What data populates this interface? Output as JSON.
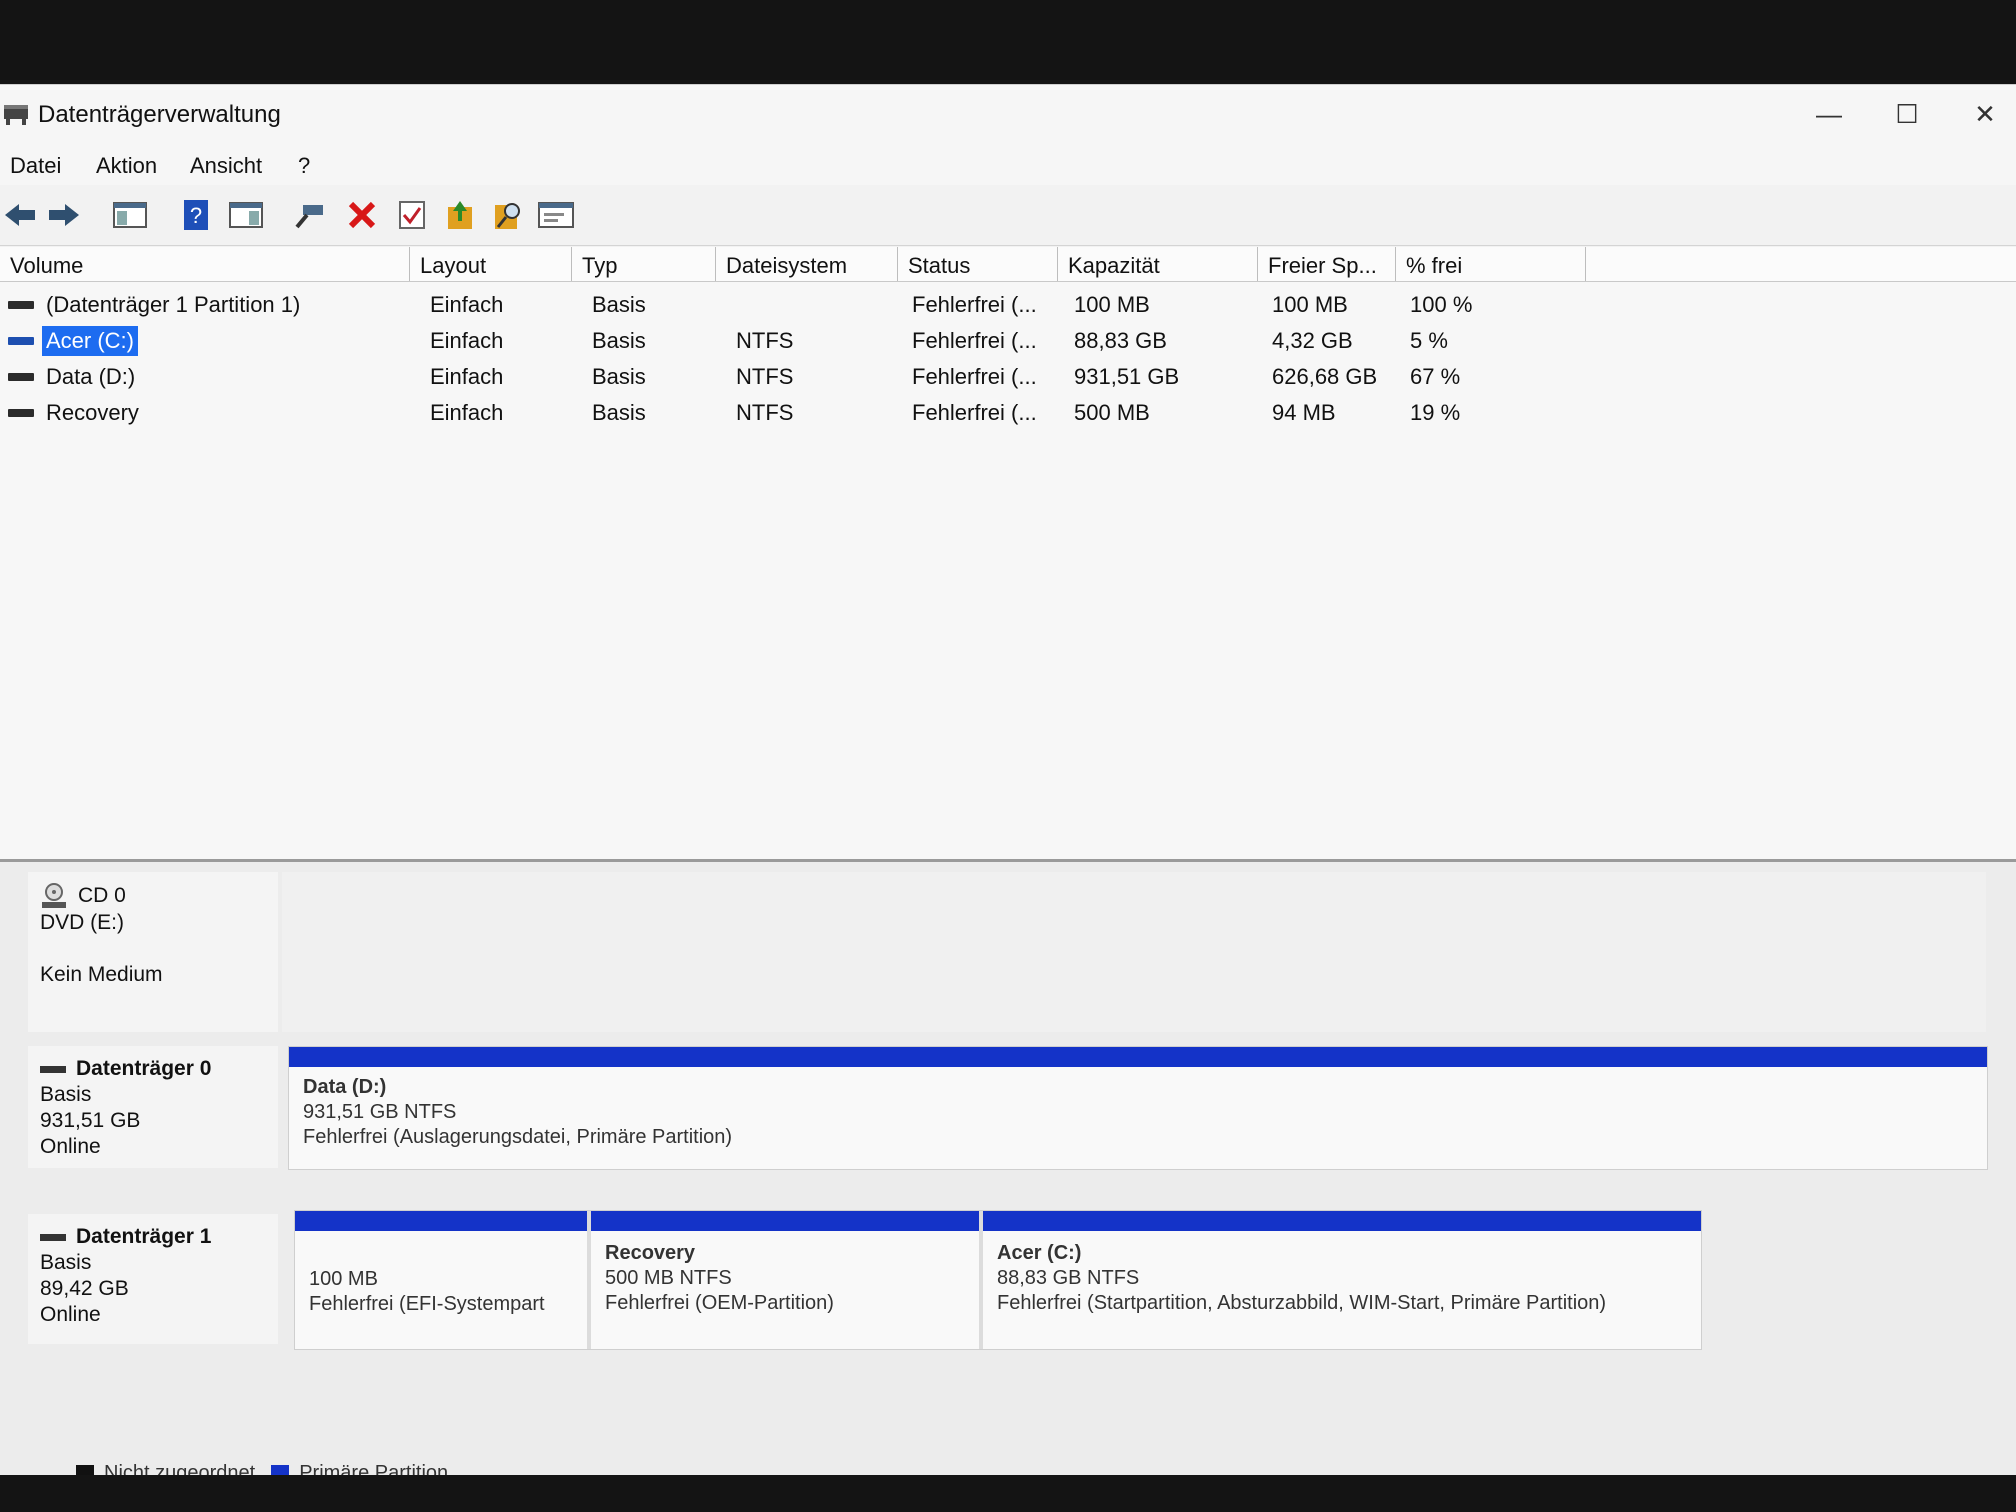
{
  "window": {
    "title": "Datenträgerverwaltung",
    "minimize": "—",
    "maximize": "☐",
    "close": "✕"
  },
  "menu": [
    "Datei",
    "Aktion",
    "Ansicht",
    "?"
  ],
  "toolbar": [
    "back-arrow-icon",
    "forward-arrow-icon",
    "console-tree-icon",
    "help-icon",
    "properties-pane-icon",
    "connect-icon",
    "delete-icon",
    "check-icon",
    "export-icon",
    "search-icon",
    "details-icon"
  ],
  "colors": {
    "primary_partition": "#1433c8",
    "unallocated": "#111111",
    "selection": "#1d6cf0"
  },
  "table": {
    "headers": [
      "Volume",
      "Layout",
      "Typ",
      "Dateisystem",
      "Status",
      "Kapazität",
      "Freier Sp...",
      "% frei"
    ],
    "rows": [
      {
        "volume": "(Datenträger 1 Partition 1)",
        "layout": "Einfach",
        "typ": "Basis",
        "fs": "",
        "status": "Fehlerfrei (...",
        "cap": "100 MB",
        "free": "100 MB",
        "pct": "100 %"
      },
      {
        "volume": "Acer (C:)",
        "layout": "Einfach",
        "typ": "Basis",
        "fs": "NTFS",
        "status": "Fehlerfrei (...",
        "cap": "88,83 GB",
        "free": "4,32 GB",
        "pct": "5 %",
        "selected": true
      },
      {
        "volume": "Data (D:)",
        "layout": "Einfach",
        "typ": "Basis",
        "fs": "NTFS",
        "status": "Fehlerfrei (...",
        "cap": "931,51 GB",
        "free": "626,68 GB",
        "pct": "67 %"
      },
      {
        "volume": "Recovery",
        "layout": "Einfach",
        "typ": "Basis",
        "fs": "NTFS",
        "status": "Fehlerfrei (...",
        "cap": "500 MB",
        "free": "94 MB",
        "pct": "19 %"
      }
    ]
  },
  "disks": {
    "cd0": {
      "name": "CD 0",
      "line1": "DVD (E:)",
      "line2": "Kein Medium"
    },
    "disk0": {
      "name": "Datenträger 0",
      "type": "Basis",
      "size": "931,51 GB",
      "status": "Online",
      "partitions": [
        {
          "title": "Data  (D:)",
          "size": "931,51 GB NTFS",
          "status": "Fehlerfrei (Auslagerungsdatei, Primäre Partition)"
        }
      ]
    },
    "disk1": {
      "name": "Datenträger 1",
      "type": "Basis",
      "size": "89,42 GB",
      "status": "Online",
      "partitions": [
        {
          "title": "",
          "size": "100 MB",
          "status": "Fehlerfrei (EFI-Systempart"
        },
        {
          "title": "Recovery",
          "size": "500 MB NTFS",
          "status": "Fehlerfrei (OEM-Partition)"
        },
        {
          "title": "Acer  (C:)",
          "size": "88,83 GB NTFS",
          "status": "Fehlerfrei (Startpartition, Absturzabbild, WIM-Start, Primäre Partition)"
        }
      ]
    }
  },
  "legend": {
    "unallocated": "Nicht zugeordnet",
    "primary": "Primäre Partition"
  }
}
